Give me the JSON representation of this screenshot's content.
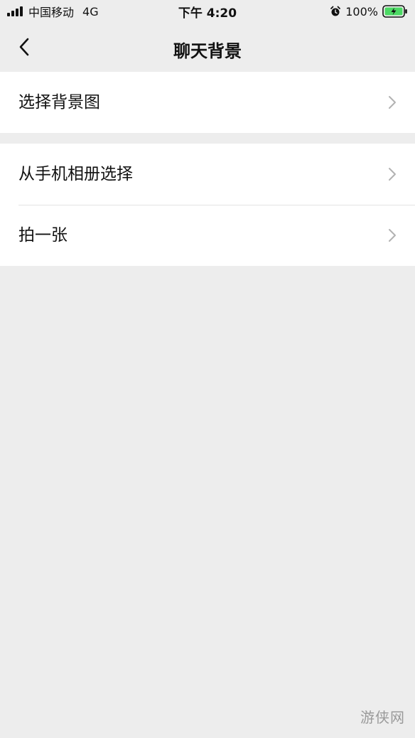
{
  "status_bar": {
    "carrier": "中国移动",
    "network": "4G",
    "time": "下午 4:20",
    "battery_percent": "100%",
    "icons": [
      "signal-icon",
      "alarm-icon",
      "battery-charging-icon"
    ]
  },
  "nav": {
    "title": "聊天背景",
    "back_icon": "chevron-left-icon"
  },
  "groups": [
    {
      "items": [
        {
          "label": "选择背景图",
          "icon": "chevron-right-icon"
        }
      ]
    },
    {
      "items": [
        {
          "label": "从手机相册选择",
          "icon": "chevron-right-icon"
        },
        {
          "label": "拍一张",
          "icon": "chevron-right-icon"
        }
      ]
    }
  ],
  "watermark": {
    "text": "游侠网"
  },
  "colors": {
    "background": "#ededed",
    "cell_background": "#ffffff",
    "text": "#111111",
    "chevron": "#b2b2b2",
    "divider": "#e4e4e4",
    "battery_fill": "#4cd964"
  }
}
